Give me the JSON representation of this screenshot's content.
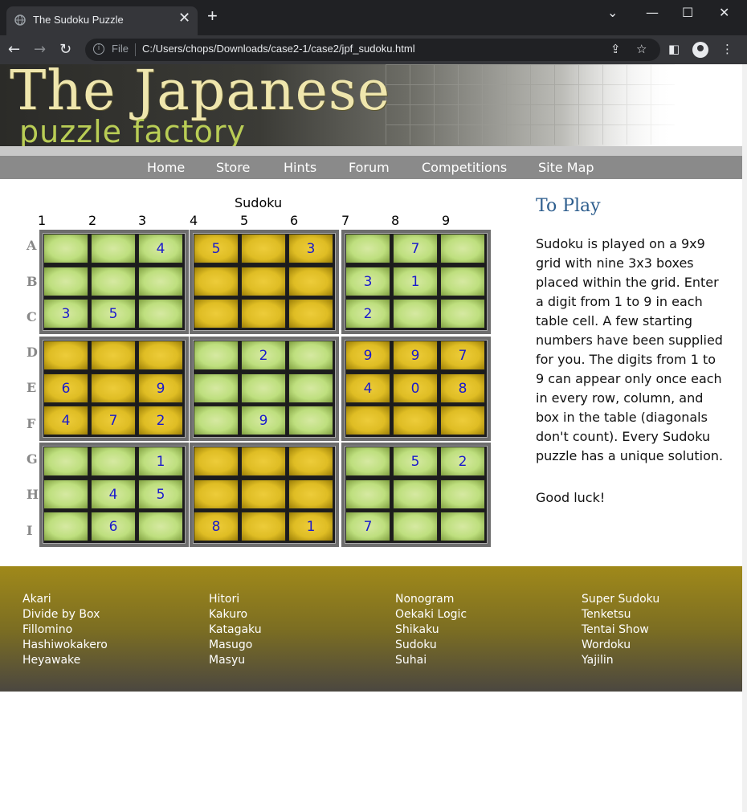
{
  "browser": {
    "tab_title": "The Sudoku Puzzle",
    "tab_close": "✕",
    "new_tab": "+",
    "window_controls": [
      "⌄",
      "—",
      "☐",
      "✕"
    ],
    "omnibox_scheme": "File",
    "url": "C:/Users/chops/Downloads/case2-1/case2/jpf_sudoku.html"
  },
  "banner": {
    "logo_line1": "The Japanese",
    "logo_line2": "puzzle factory"
  },
  "nav": [
    "Home",
    "Store",
    "Hints",
    "Forum",
    "Competitions",
    "Site Map"
  ],
  "sudoku": {
    "title": "Sudoku",
    "col_labels": [
      "1",
      "2",
      "3",
      "4",
      "5",
      "6",
      "7",
      "8",
      "9"
    ],
    "row_labels": [
      "A",
      "B",
      "C",
      "D",
      "E",
      "F",
      "G",
      "H",
      "I"
    ],
    "grid": [
      [
        "",
        "",
        "4",
        "5",
        "",
        "3",
        "",
        "7",
        ""
      ],
      [
        "",
        "",
        "",
        "",
        "",
        "",
        "3",
        "1",
        ""
      ],
      [
        "3",
        "5",
        "",
        "",
        "",
        "",
        "2",
        "",
        ""
      ],
      [
        "",
        "",
        "",
        "",
        "2",
        "",
        "9",
        "9",
        "7"
      ],
      [
        "6",
        "",
        "9",
        "",
        "",
        "",
        "4",
        "0",
        "8"
      ],
      [
        "4",
        "7",
        "2",
        "",
        "9",
        "",
        "",
        "",
        ""
      ],
      [
        "",
        "",
        "1",
        "",
        "",
        "",
        "",
        "5",
        "2"
      ],
      [
        "",
        "4",
        "5",
        "",
        "",
        "",
        "",
        "",
        ""
      ],
      [
        "",
        "6",
        "",
        "8",
        "",
        "1",
        "7",
        "",
        ""
      ]
    ],
    "colors": {
      "green": "#c2e083",
      "gold": "#e0be26",
      "digit": "#1a1acc"
    }
  },
  "to_play": {
    "title": "To Play",
    "lines": [
      "Sudoku is played on a 9x9",
      "grid with nine 3x3 boxes",
      "placed within the grid. Enter",
      "a digit from 1 to 9 in each",
      "table cell. A few starting",
      "numbers have been supplied",
      "for you. The digits from 1 to",
      "9 can appear only once each",
      "in every row, column, and",
      "box in the table (diagonals",
      "don't count). Every Sudoku",
      "puzzle has a unique solution."
    ],
    "good_luck": "Good luck!"
  },
  "footer": {
    "columns": [
      [
        "Akari",
        "Divide by Box",
        "Fillomino",
        "Hashiwokakero",
        "Heyawake"
      ],
      [
        "Hitori",
        "Kakuro",
        "Katagaku",
        "Masugo",
        "Masyu"
      ],
      [
        "Nonogram",
        "Oekaki Logic",
        "Shikaku",
        "Sudoku",
        "Suhai"
      ],
      [
        "Super Sudoku",
        "Tenketsu",
        "Tentai Show",
        "Wordoku",
        "Yajilin"
      ]
    ]
  }
}
